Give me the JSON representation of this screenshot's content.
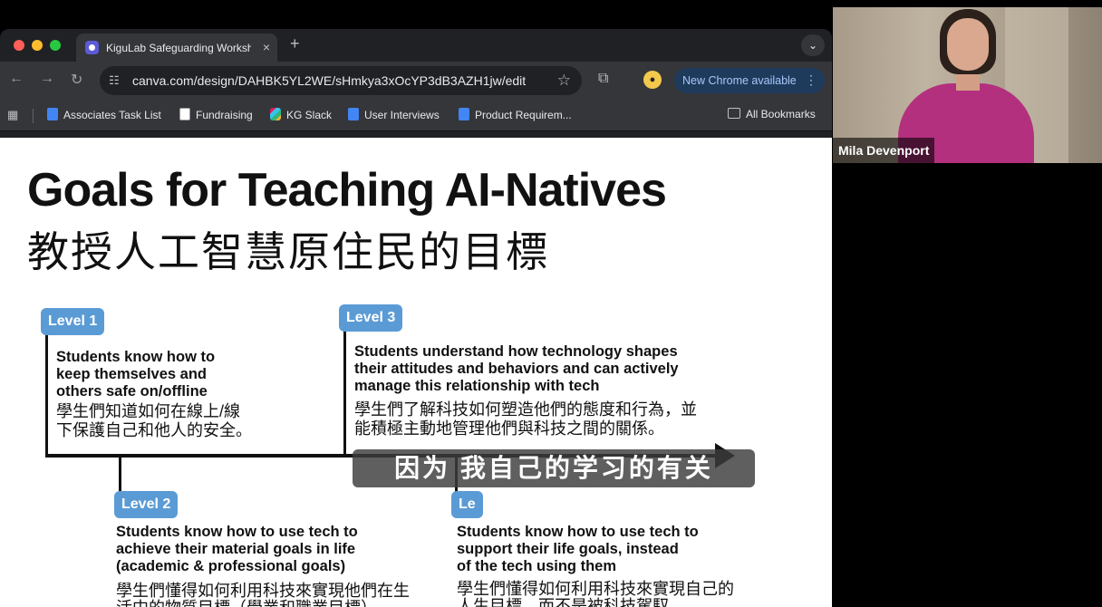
{
  "browser": {
    "tab_title": "KiguLab Safeguarding Worksh",
    "tab_close": "×",
    "new_tab": "+",
    "tab_menu": "⌄",
    "url": "canva.com/design/DAHBK5YL2WE/sHmkya3xOcYP3dB3AZH1jw/edit",
    "update_label": "New Chrome available",
    "bookmarks": [
      "Associates Task List",
      "Fundraising",
      "KG Slack",
      "User Interviews",
      "Product Requirem...",
      "All Bookmarks"
    ]
  },
  "slide": {
    "title": "Goals for Teaching AI-Natives",
    "subtitle": "教授人工智慧原住民的目標",
    "levels": [
      {
        "label": "Level 1",
        "en": [
          "Students know how to",
          "keep themselves and",
          "others safe on/offline"
        ],
        "zh": [
          "學生們知道如何在線上/線",
          "下保護自己和他人的安全。"
        ]
      },
      {
        "label": "Level 2",
        "en": [
          "Students know how to use tech to",
          "achieve their material goals in life",
          "(academic & professional goals)"
        ],
        "zh": [
          "學生們懂得如何利用科技來實現他們在生",
          "活中的物質目標（學業和職業目標）。"
        ]
      },
      {
        "label": "Level 3",
        "en": [
          "Students understand how technology shapes",
          "their attitudes and behaviors and can actively",
          "manage this relationship with tech"
        ],
        "zh": [
          "學生們了解科技如何塑造他們的態度和行為，並",
          "能積極主動地管理他們與科技之間的關係。"
        ]
      },
      {
        "label": "Le",
        "en": [
          "Students know how to use tech to",
          "support their life goals, instead",
          "of the tech using them"
        ],
        "zh": [
          "學生們懂得如何利用科技來實現自己的",
          "人生目標，而不是被科技駕馭。"
        ]
      }
    ]
  },
  "video": {
    "participant_name": "Mila Devenport"
  },
  "caption": {
    "text": "因为 我自己的学习的有关"
  }
}
